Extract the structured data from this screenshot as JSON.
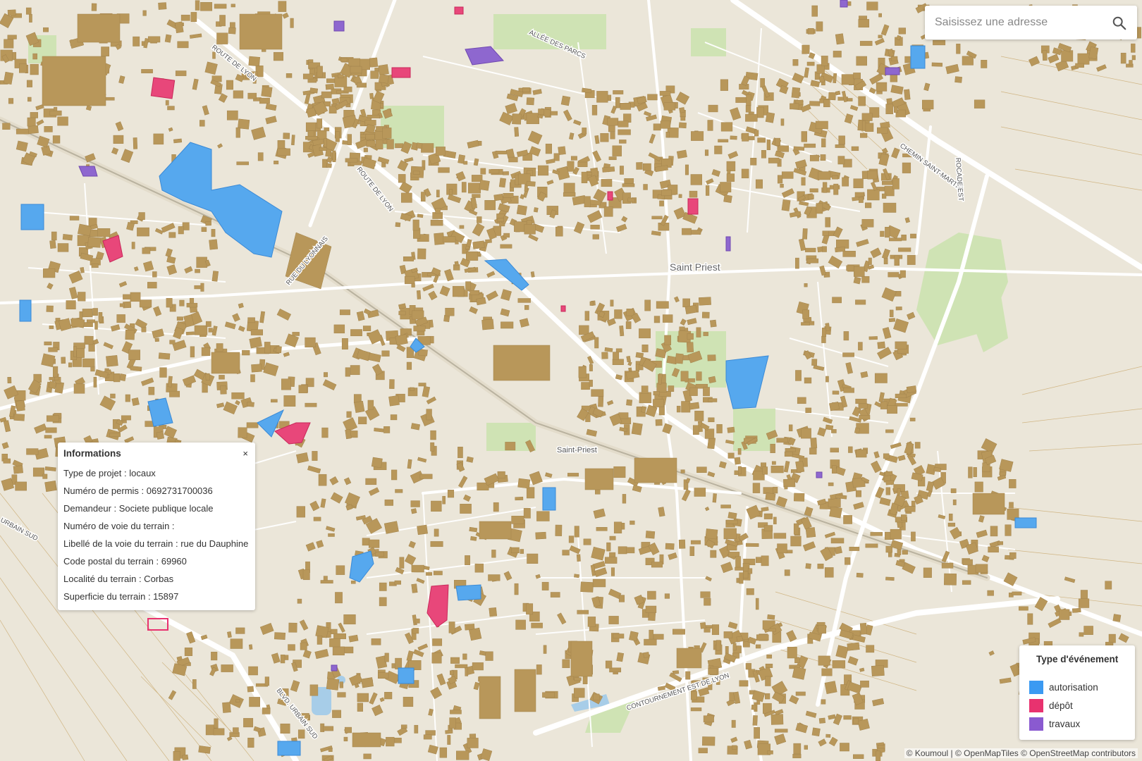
{
  "search": {
    "placeholder": "Saisissez une adresse",
    "icon": "search-icon"
  },
  "info_panel": {
    "title": "Informations",
    "close_label": "×",
    "rows": [
      "Type de projet : locaux",
      "Numéro de permis : 0692731700036",
      "Demandeur : Societe publique locale",
      "Numéro de voie du terrain :",
      "Libellé de la voie du terrain : rue du Dauphine",
      "Code postal du terrain : 69960",
      "Localité du terrain : Corbas",
      "Superficie du terrain : 15897"
    ]
  },
  "legend": {
    "title": "Type d'événement",
    "items": [
      {
        "label": "autorisation",
        "color": "#3b9af2"
      },
      {
        "label": "dépôt",
        "color": "#e8326f"
      },
      {
        "label": "travaux",
        "color": "#8a5ad0"
      }
    ]
  },
  "map_labels": {
    "city": "Saint Priest",
    "station": "Saint-Priest",
    "route_de_lyon_1": "ROUTE DE LYON",
    "route_de_lyon_2": "ROUTE DE LYON",
    "allee_des_parcs": "ALLÉE DES PARCS",
    "rue_du_lyonnais": "RUE DU LYONNAIS",
    "chemin_saint_martin": "CHEMIN SAINT-MARTIN",
    "rocade_est": "ROCADE EST",
    "contournement": "CONTOURNEMENT EST DE LYON",
    "blvd_urbain_sud": "BLVD. URBAIN SUD",
    "urbain_sud": "URBAIN SUD"
  },
  "attribution": "© Koumoul | © OpenMapTiles © OpenStreetMap contributors",
  "colors": {
    "background": "#ebe6d9",
    "building": "#b8975a",
    "road": "#ffffff",
    "green": "#cfe3b4",
    "water": "#a7cde8"
  }
}
